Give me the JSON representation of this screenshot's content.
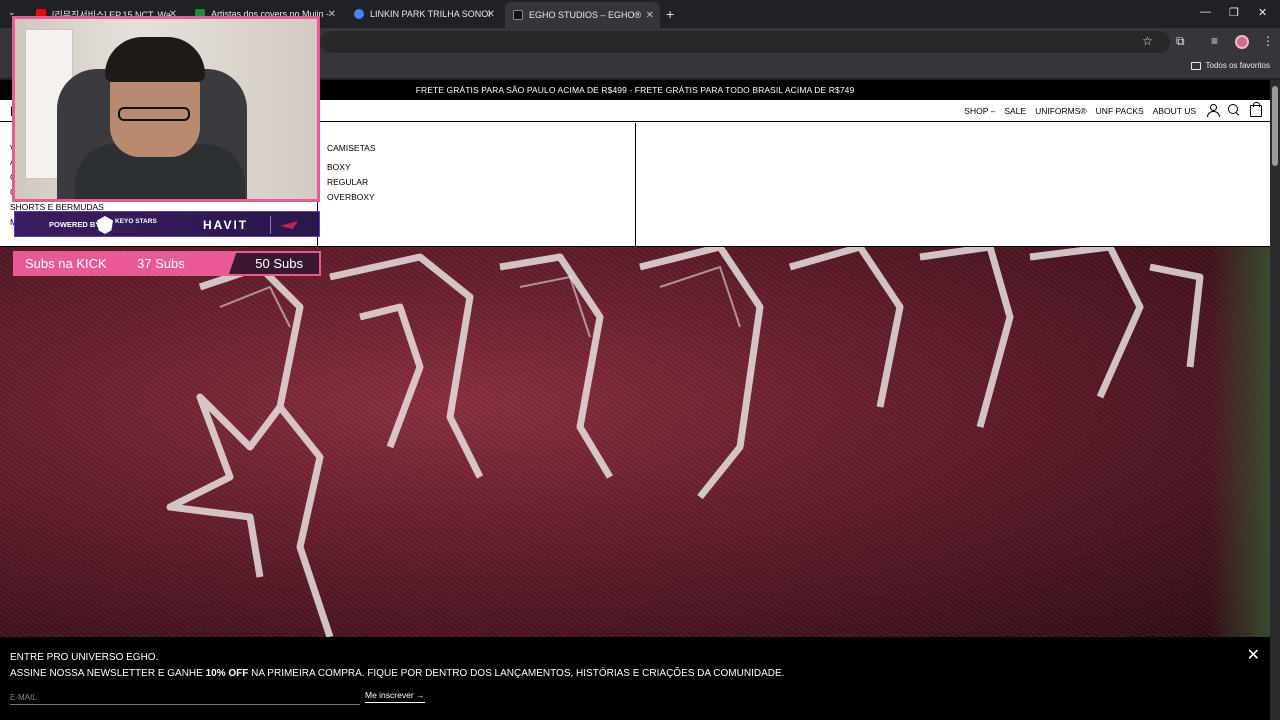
{
  "browser": {
    "tabs": [
      {
        "title": "[리무진서비스] EP.15 NCT. Wa",
        "favicon": "youtube-icon",
        "color": "#ff0000"
      },
      {
        "title": "Artistas dos covers no Mujin - (",
        "favicon": "sheets-icon",
        "color": "#1e8e3e"
      },
      {
        "title": "LINKIN PARK TRILHA SONORA",
        "favicon": "chrome-icon",
        "color": "#4285f4"
      },
      {
        "title": "EGHO STUDIOS – EGHO®",
        "favicon": "egho-icon",
        "color": "#000000"
      }
    ],
    "new_tab": "+",
    "bookmarks_all": "Todos os favoritos"
  },
  "site": {
    "announcement": "FRETE GRÁTIS PARA SÃO PAULO ACIMA DE R$499 - FRETE GRÁTIS PARA TODO BRASIL ACIMA DE R$749",
    "logo": "E",
    "nav": [
      "SHOP –",
      "SALE",
      "UNIFORMS®",
      "UNF PACKS",
      "ABOUT US"
    ],
    "mega": {
      "col1": [
        "V",
        "A",
        "C",
        "C",
        "SHORTS E BERMUDAS",
        "M"
      ],
      "col2_heading": "CAMISETAS",
      "col2_items": [
        "BOXY",
        "REGULAR",
        "OVERBOXY"
      ]
    },
    "newsletter": {
      "title": "ENTRE PRO UNIVERSO EGHO.",
      "sub_prefix": "ASSINE NOSSA NEWSLETTER E GANHE ",
      "sub_bold": "10% OFF",
      "sub_suffix": " NA PRIMEIRA COMPRA. FIQUE POR DENTRO DOS LANÇAMENTOS, HISTÓRIAS E CRIAÇÕES DA COMUNIDADE.",
      "placeholder": "E-MAIL",
      "button": "Me inscrever →",
      "close": "✕"
    }
  },
  "overlay": {
    "sponsor_powered": "POWERED BY",
    "sponsor_keyo": "KEYO STARS",
    "sponsor_havit": "HAVIT",
    "subs_label": "Subs na KICK",
    "subs_current": "37 Subs",
    "subs_goal": "50 Subs",
    "accent": "#e85a94"
  }
}
